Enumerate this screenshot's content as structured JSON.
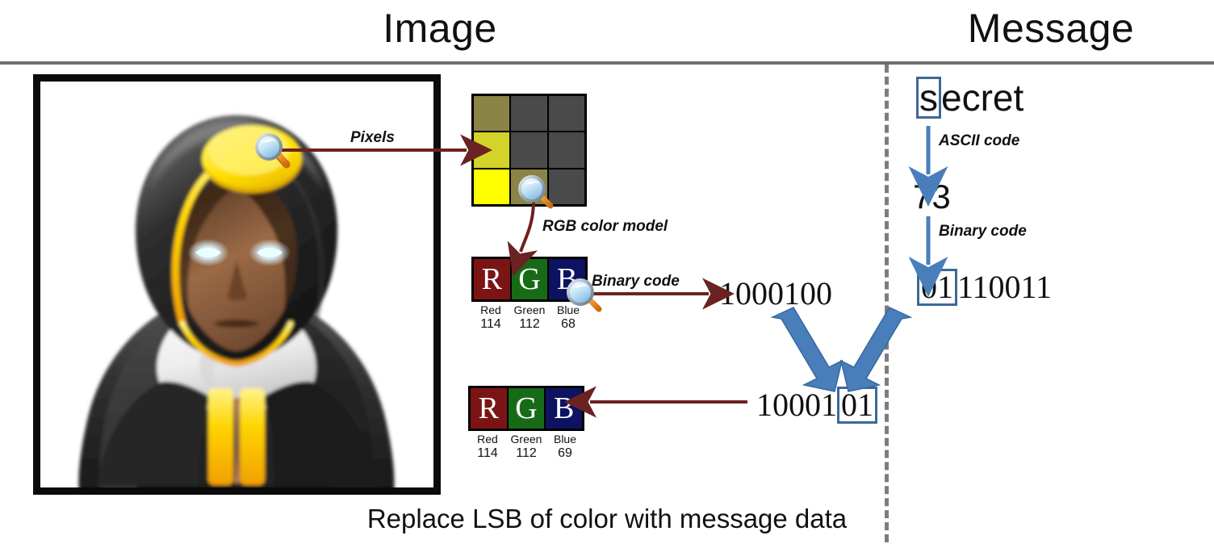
{
  "header": {
    "left_title": "Image",
    "right_title": "Message"
  },
  "cover_image": {
    "alt_name": "hooded-monk-avatar",
    "frame_border_color": "#0b0b0b",
    "robe_color": "#2b2b2b",
    "accent_gold": "#ffd400",
    "skin_color": "#8b5e3c",
    "collar_color": "#f2f2f2",
    "eye_glow_color": "#d8f3ff"
  },
  "pixel_grid": {
    "label": "Pixels",
    "cells": [
      "#8a8447",
      "#4a4a4a",
      "#4a4a4a",
      "#d4d32a",
      "#4a4a4a",
      "#4a4a4a",
      "#ffff00",
      "#8a8447",
      "#4a4a4a"
    ]
  },
  "rgb_model": {
    "label": "RGB color model",
    "channel_letters": [
      "R",
      "G",
      "B"
    ],
    "channel_names": [
      "Red",
      "Green",
      "Blue"
    ],
    "channel_colors": [
      "#7b1515",
      "#176b17",
      "#0d1361"
    ],
    "original_values": [
      "114",
      "112",
      "68"
    ],
    "modified_values": [
      "114",
      "112",
      "69"
    ]
  },
  "image_binary": {
    "label": "Binary code",
    "original": "1000100",
    "modified_prefix": "10001",
    "modified_boxed": "01"
  },
  "message": {
    "text": "secret",
    "boxed_char": "s",
    "rest_chars": "ecret",
    "ascii_label": "ASCII code",
    "ascii_value": "73",
    "binary_label": "Binary code",
    "binary_boxed": "01",
    "binary_rest": "110011"
  },
  "caption": "Replace LSB of color with message data",
  "colors": {
    "arrow_dark_red": "#6b2222",
    "arrow_blue": "#4a7ebb",
    "divider_gray": "#7d7d7d",
    "rule_gray": "#6e6e6e",
    "highlight_box_blue": "#3c6997"
  }
}
